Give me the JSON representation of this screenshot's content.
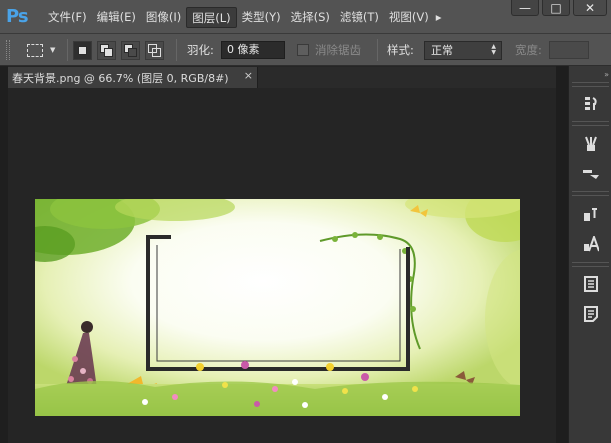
{
  "app": {
    "logo": "Ps"
  },
  "menu": {
    "items": [
      "文件(F)",
      "编辑(E)",
      "图像(I)",
      "图层(L)",
      "类型(Y)",
      "选择(S)",
      "滤镜(T)",
      "视图(V)"
    ],
    "active": "图层(L)",
    "overflow": "▸"
  },
  "window": {
    "minimize": "—",
    "restore": "□",
    "close": "✕"
  },
  "options": {
    "feather_label": "羽化:",
    "feather_value": "0 像素",
    "antialias_label": "消除锯齿",
    "style_label": "样式:",
    "style_value": "正常",
    "width_label": "宽度:",
    "width_value": ""
  },
  "document": {
    "tab_title": "春天背景.png @ 66.7% (图层 0, RGB/8#)",
    "close_glyph": "×"
  },
  "dock": {
    "icons": [
      "history-icon",
      "brush-presets-icon",
      "clone-source-icon",
      "character-styles-icon",
      "character-icon",
      "layers-icon",
      "notes-icon"
    ]
  },
  "colors": {
    "chrome": "#535353",
    "workspace": "#252525",
    "ps_blue": "#4aa3e8"
  }
}
